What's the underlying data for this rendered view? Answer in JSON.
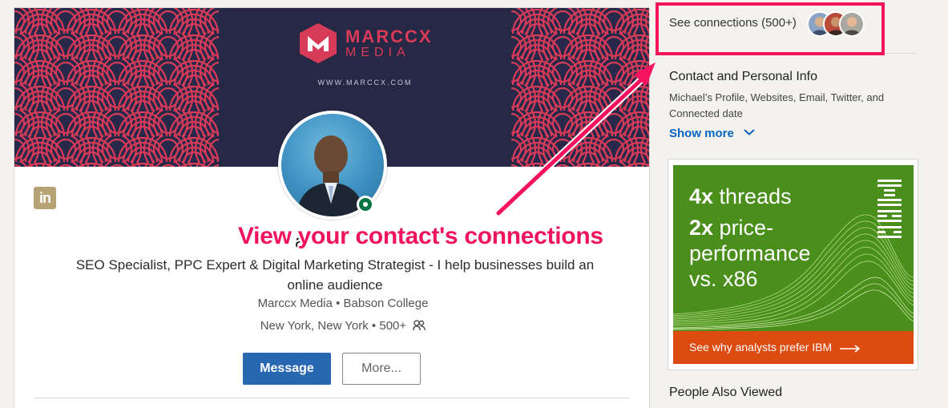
{
  "profile": {
    "brand": {
      "name": "MARCCX",
      "sub": "MEDIA",
      "url": "WWW.MARCCX.COM"
    },
    "name_partial": "a",
    "headline": "SEO Specialist, PPC Expert & Digital Marketing Strategist - I help businesses build an online audience",
    "company_line": "Marccx Media • Babson College",
    "location_line": "New York, New York • 500+",
    "message_label": "Message",
    "more_label": "More...",
    "online_status": "online",
    "colors": {
      "banner_bg": "#27284a",
      "pattern": "#d83b57",
      "message_button": "#2867b2",
      "online_dot": "#057642"
    }
  },
  "sidebar": {
    "see_connections": "See connections (500+)",
    "contact_title": "Contact and Personal Info",
    "contact_desc": "Michael’s Profile, Websites, Email, Twitter, and Connected date",
    "show_more": "Show more",
    "people_also_viewed": "People Also Viewed"
  },
  "ad": {
    "line1_strong": "4x",
    "line1_rest": " threads",
    "line2_strong": "2x",
    "line2_rest": " price-performance vs. x86",
    "cta": "See why analysts prefer IBM",
    "colors": {
      "background": "#4a8e1c",
      "cta": "#dc4b0f"
    }
  },
  "annotation": {
    "callout": "View your contact's connections",
    "color": "#f5135f"
  },
  "icons": [
    "linkedin-icon",
    "people-icon",
    "chevron-down-icon",
    "arrow-right-icon",
    "ibm-logo-icon",
    "online-status-icon"
  ]
}
